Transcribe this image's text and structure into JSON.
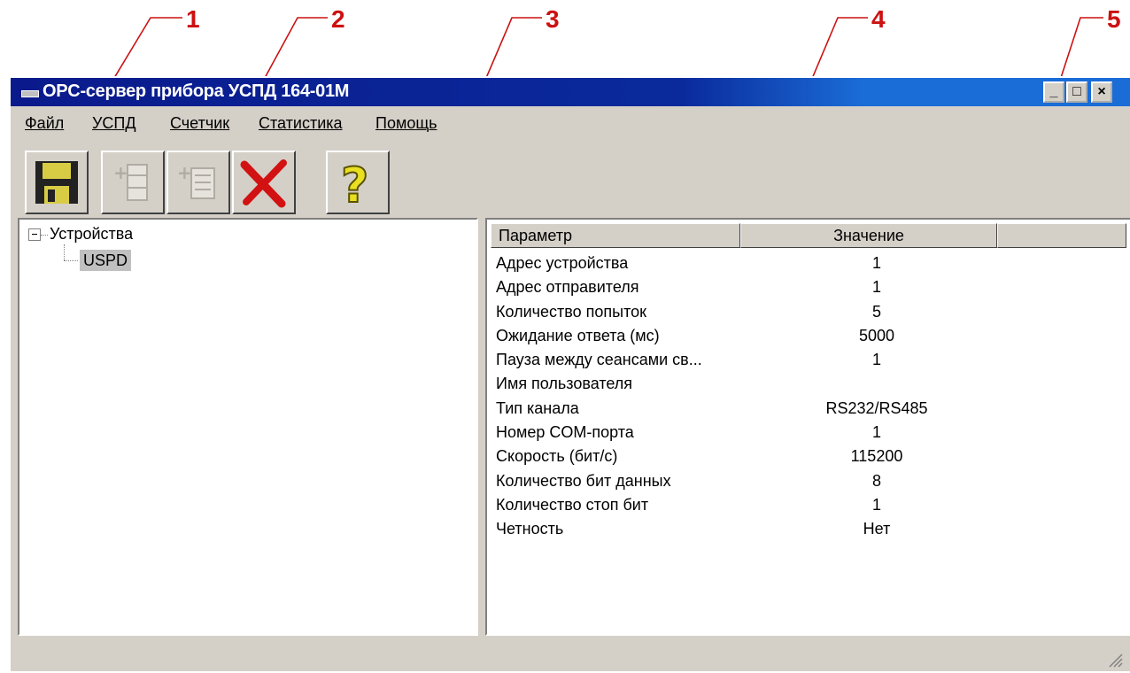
{
  "callouts": [
    "1",
    "2",
    "3",
    "4",
    "5"
  ],
  "window": {
    "title": "OPC-сервер прибора УСПД 164-01М",
    "controls": {
      "minimize": "_",
      "maximize": "□",
      "close": "×"
    }
  },
  "menu": {
    "items": [
      "Файл",
      "УСПД",
      "Счетчик",
      "Статистика",
      "Помощь"
    ]
  },
  "toolbar": {
    "buttons": [
      {
        "icon": "save-disk-icon",
        "enabled": true
      },
      {
        "icon": "add-device-icon",
        "enabled": false
      },
      {
        "icon": "add-meter-icon",
        "enabled": false
      },
      {
        "icon": "delete-cross-icon",
        "enabled": true
      },
      {
        "icon": "help-question-icon",
        "enabled": true
      }
    ]
  },
  "tree": {
    "root": "Устройства",
    "children": [
      "USPD"
    ]
  },
  "properties": {
    "columns": [
      "Параметр",
      "Значение",
      ""
    ],
    "rows": [
      {
        "name": "Адрес устройства",
        "value": "1"
      },
      {
        "name": "Адрес отправителя",
        "value": "1"
      },
      {
        "name": "Количество попыток",
        "value": "5"
      },
      {
        "name": "Ожидание ответа (мс)",
        "value": "5000"
      },
      {
        "name": "Пауза между сеансами св...",
        "value": "1"
      },
      {
        "name": "Имя пользователя",
        "value": ""
      },
      {
        "name": "Тип канала",
        "value": "RS232/RS485"
      },
      {
        "name": "Номер COM-порта",
        "value": "1"
      },
      {
        "name": "Скорость (бит/с)",
        "value": "115200"
      },
      {
        "name": "Количество бит данных",
        "value": "8"
      },
      {
        "name": "Количество стоп бит",
        "value": "1"
      },
      {
        "name": "Четность",
        "value": "Нет"
      }
    ]
  },
  "colors": {
    "callout": "#cc1111",
    "titlebar_start": "#0a1a8c",
    "titlebar_end": "#1a6cd6",
    "face": "#d4d0c8"
  }
}
